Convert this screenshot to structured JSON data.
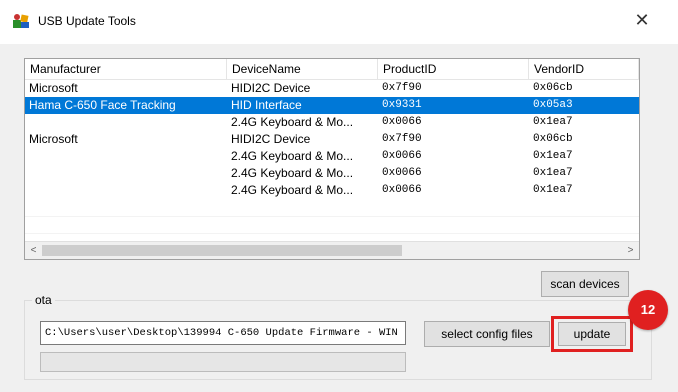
{
  "window": {
    "title": "USB Update Tools",
    "close_glyph": "✕",
    "icon": "usb-tools-icon"
  },
  "table": {
    "columns": [
      "Manufacturer",
      "DeviceName",
      "ProductID",
      "VendorID"
    ],
    "rows": [
      {
        "manufacturer": "Microsoft",
        "device": "HIDI2C Device",
        "product": "0x7f90",
        "vendor": "0x06cb",
        "selected": false
      },
      {
        "manufacturer": "Hama C-650 Face Tracking",
        "device": "HID Interface",
        "product": "0x9331",
        "vendor": "0x05a3",
        "selected": true
      },
      {
        "manufacturer": "",
        "device": "2.4G Keyboard & Mo...",
        "product": "0x0066",
        "vendor": "0x1ea7",
        "selected": false
      },
      {
        "manufacturer": "Microsoft",
        "device": "HIDI2C Device",
        "product": "0x7f90",
        "vendor": "0x06cb",
        "selected": false
      },
      {
        "manufacturer": "",
        "device": "2.4G Keyboard & Mo...",
        "product": "0x0066",
        "vendor": "0x1ea7",
        "selected": false
      },
      {
        "manufacturer": "",
        "device": "2.4G Keyboard & Mo...",
        "product": "0x0066",
        "vendor": "0x1ea7",
        "selected": false
      },
      {
        "manufacturer": "",
        "device": "2.4G Keyboard & Mo...",
        "product": "0x0066",
        "vendor": "0x1ea7",
        "selected": false
      }
    ],
    "scroll_left_glyph": "<",
    "scroll_right_glyph": ">"
  },
  "buttons": {
    "scan": "scan devices",
    "select_config": "select config files",
    "update": "update"
  },
  "ota": {
    "label": "ota",
    "path": "C:\\Users\\user\\Desktop\\139994 C-650 Update Firmware - WIN"
  },
  "annotation": {
    "step": "12",
    "color": "#e02020"
  },
  "colors": {
    "selection": "#0078d7"
  }
}
